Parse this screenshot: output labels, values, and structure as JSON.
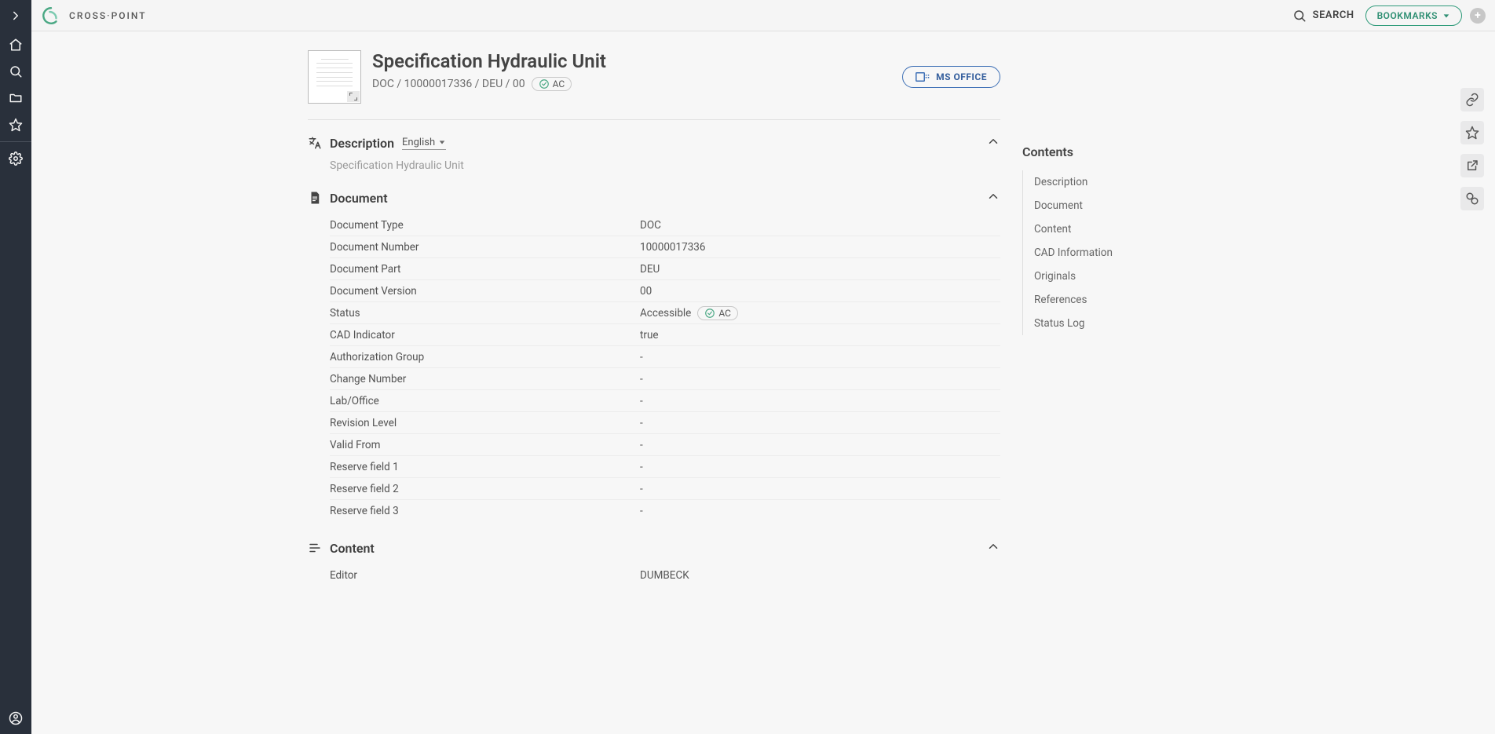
{
  "brand": "CROSS·POINT",
  "header": {
    "search_label": "SEARCH",
    "bookmarks_label": "BOOKMARKS"
  },
  "doc": {
    "title": "Specification Hydraulic Unit",
    "meta": "DOC / 10000017336 / DEU / 00",
    "status_code": "AC",
    "ms_office_label": "MS OFFICE"
  },
  "sections": {
    "description": {
      "title": "Description",
      "language": "English",
      "text": "Specification Hydraulic Unit"
    },
    "document": {
      "title": "Document",
      "status_text": "Accessible",
      "fields": [
        {
          "label": "Document Type",
          "value": "DOC"
        },
        {
          "label": "Document Number",
          "value": "10000017336"
        },
        {
          "label": "Document Part",
          "value": "DEU"
        },
        {
          "label": "Document Version",
          "value": "00"
        },
        {
          "label": "Status",
          "value": "Accessible",
          "pill": "AC"
        },
        {
          "label": "CAD Indicator",
          "value": "true"
        },
        {
          "label": "Authorization Group",
          "value": "-"
        },
        {
          "label": "Change Number",
          "value": "-"
        },
        {
          "label": "Lab/Office",
          "value": "-"
        },
        {
          "label": "Revision Level",
          "value": "-"
        },
        {
          "label": "Valid From",
          "value": "-"
        },
        {
          "label": "Reserve field 1",
          "value": "-"
        },
        {
          "label": "Reserve field 2",
          "value": "-"
        },
        {
          "label": "Reserve field 3",
          "value": "-"
        }
      ]
    },
    "content": {
      "title": "Content",
      "fields": [
        {
          "label": "Editor",
          "value": "DUMBECK"
        }
      ]
    }
  },
  "toc": {
    "title": "Contents",
    "items": [
      "Description",
      "Document",
      "Content",
      "CAD Information",
      "Originals",
      "References",
      "Status Log"
    ]
  }
}
